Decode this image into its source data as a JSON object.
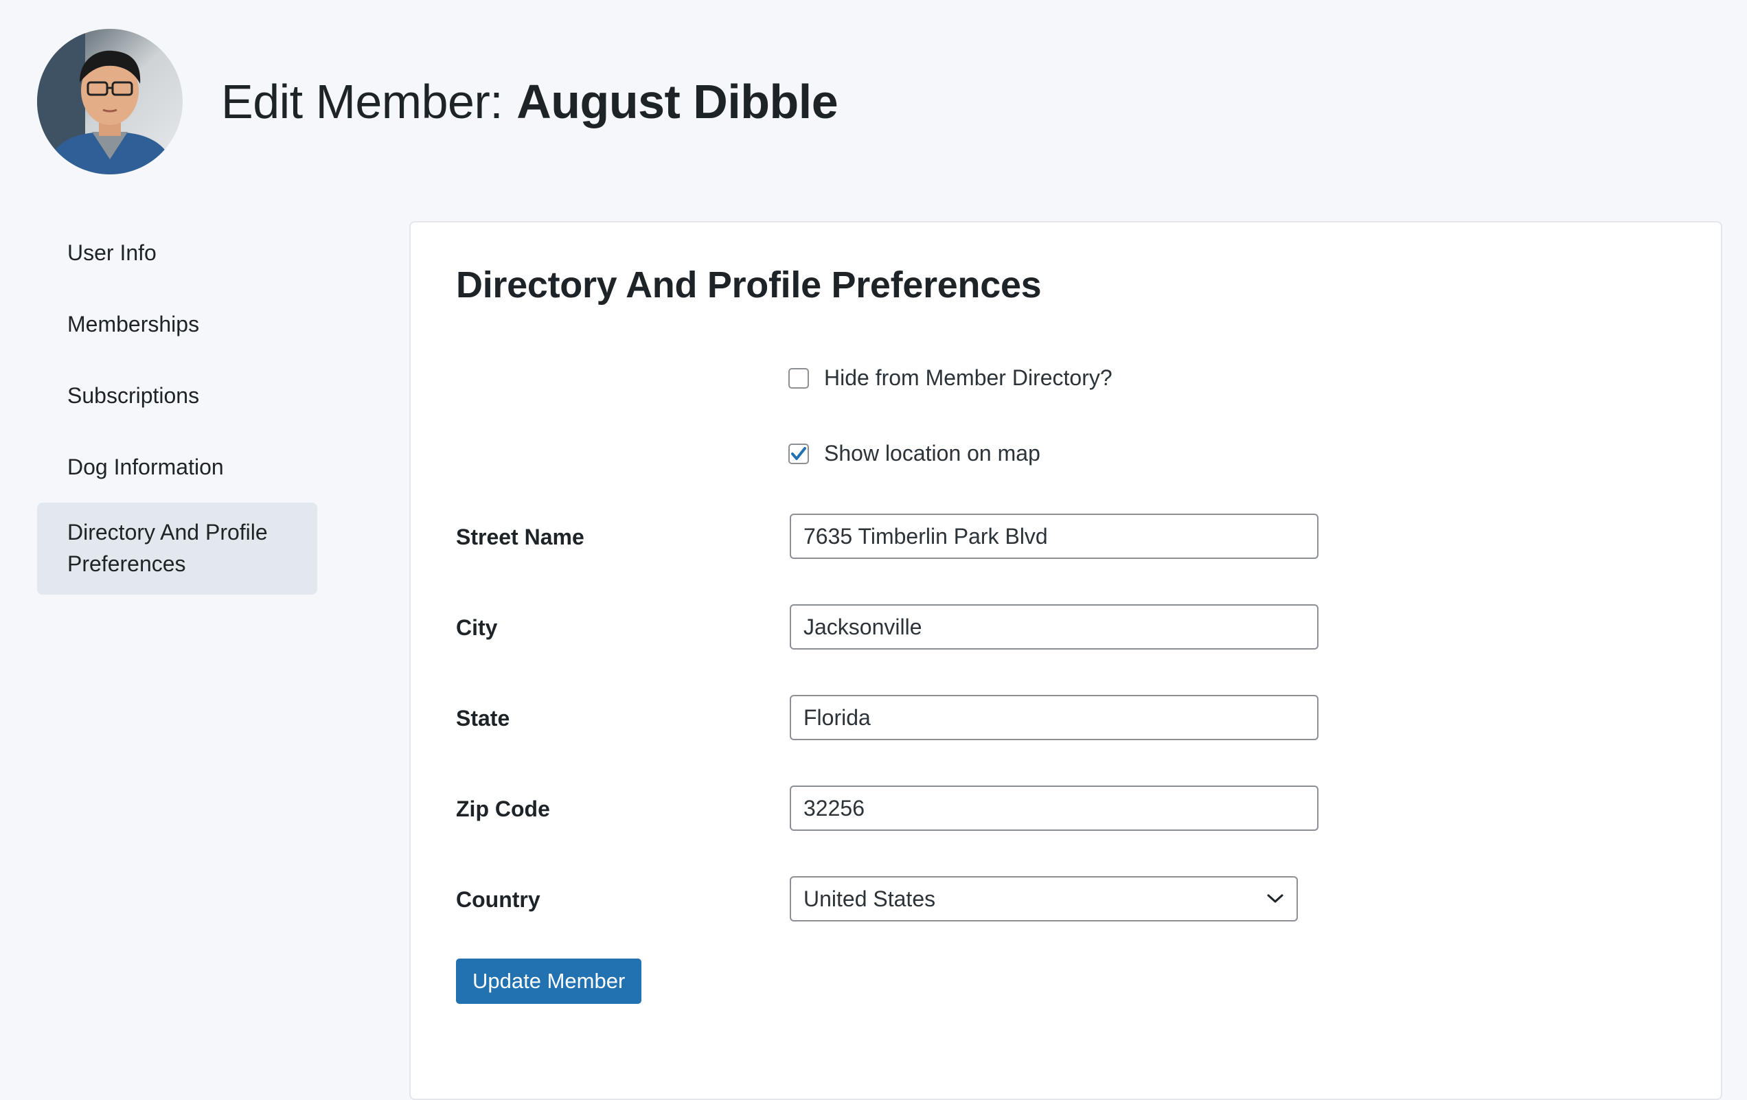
{
  "header": {
    "title_prefix": "Edit Member:",
    "member_name": "August Dibble",
    "avatar_icon": "avatar-photo-icon"
  },
  "sidebar": {
    "items": [
      {
        "label": "User Info",
        "active": false
      },
      {
        "label": "Memberships",
        "active": false
      },
      {
        "label": "Subscriptions",
        "active": false
      },
      {
        "label": "Dog Information",
        "active": false
      },
      {
        "label": "Directory And Profile Preferences",
        "active": true
      }
    ]
  },
  "main": {
    "title": "Directory And Profile Preferences",
    "checkboxes": [
      {
        "label": "Hide from Member Directory?",
        "checked": false
      },
      {
        "label": "Show location on map",
        "checked": true
      }
    ],
    "fields": {
      "street": {
        "label": "Street Name",
        "value": "7635 Timberlin Park Blvd"
      },
      "city": {
        "label": "City",
        "value": "Jacksonville"
      },
      "state": {
        "label": "State",
        "value": "Florida"
      },
      "zip": {
        "label": "Zip Code",
        "value": "32256"
      },
      "country": {
        "label": "Country",
        "value": "United States"
      }
    },
    "submit_label": "Update Member"
  },
  "colors": {
    "background": "#f6f7fb",
    "card": "#ffffff",
    "active_nav": "#e3e8ef",
    "primary": "#2271b1",
    "checkmark": "#2271b1"
  }
}
